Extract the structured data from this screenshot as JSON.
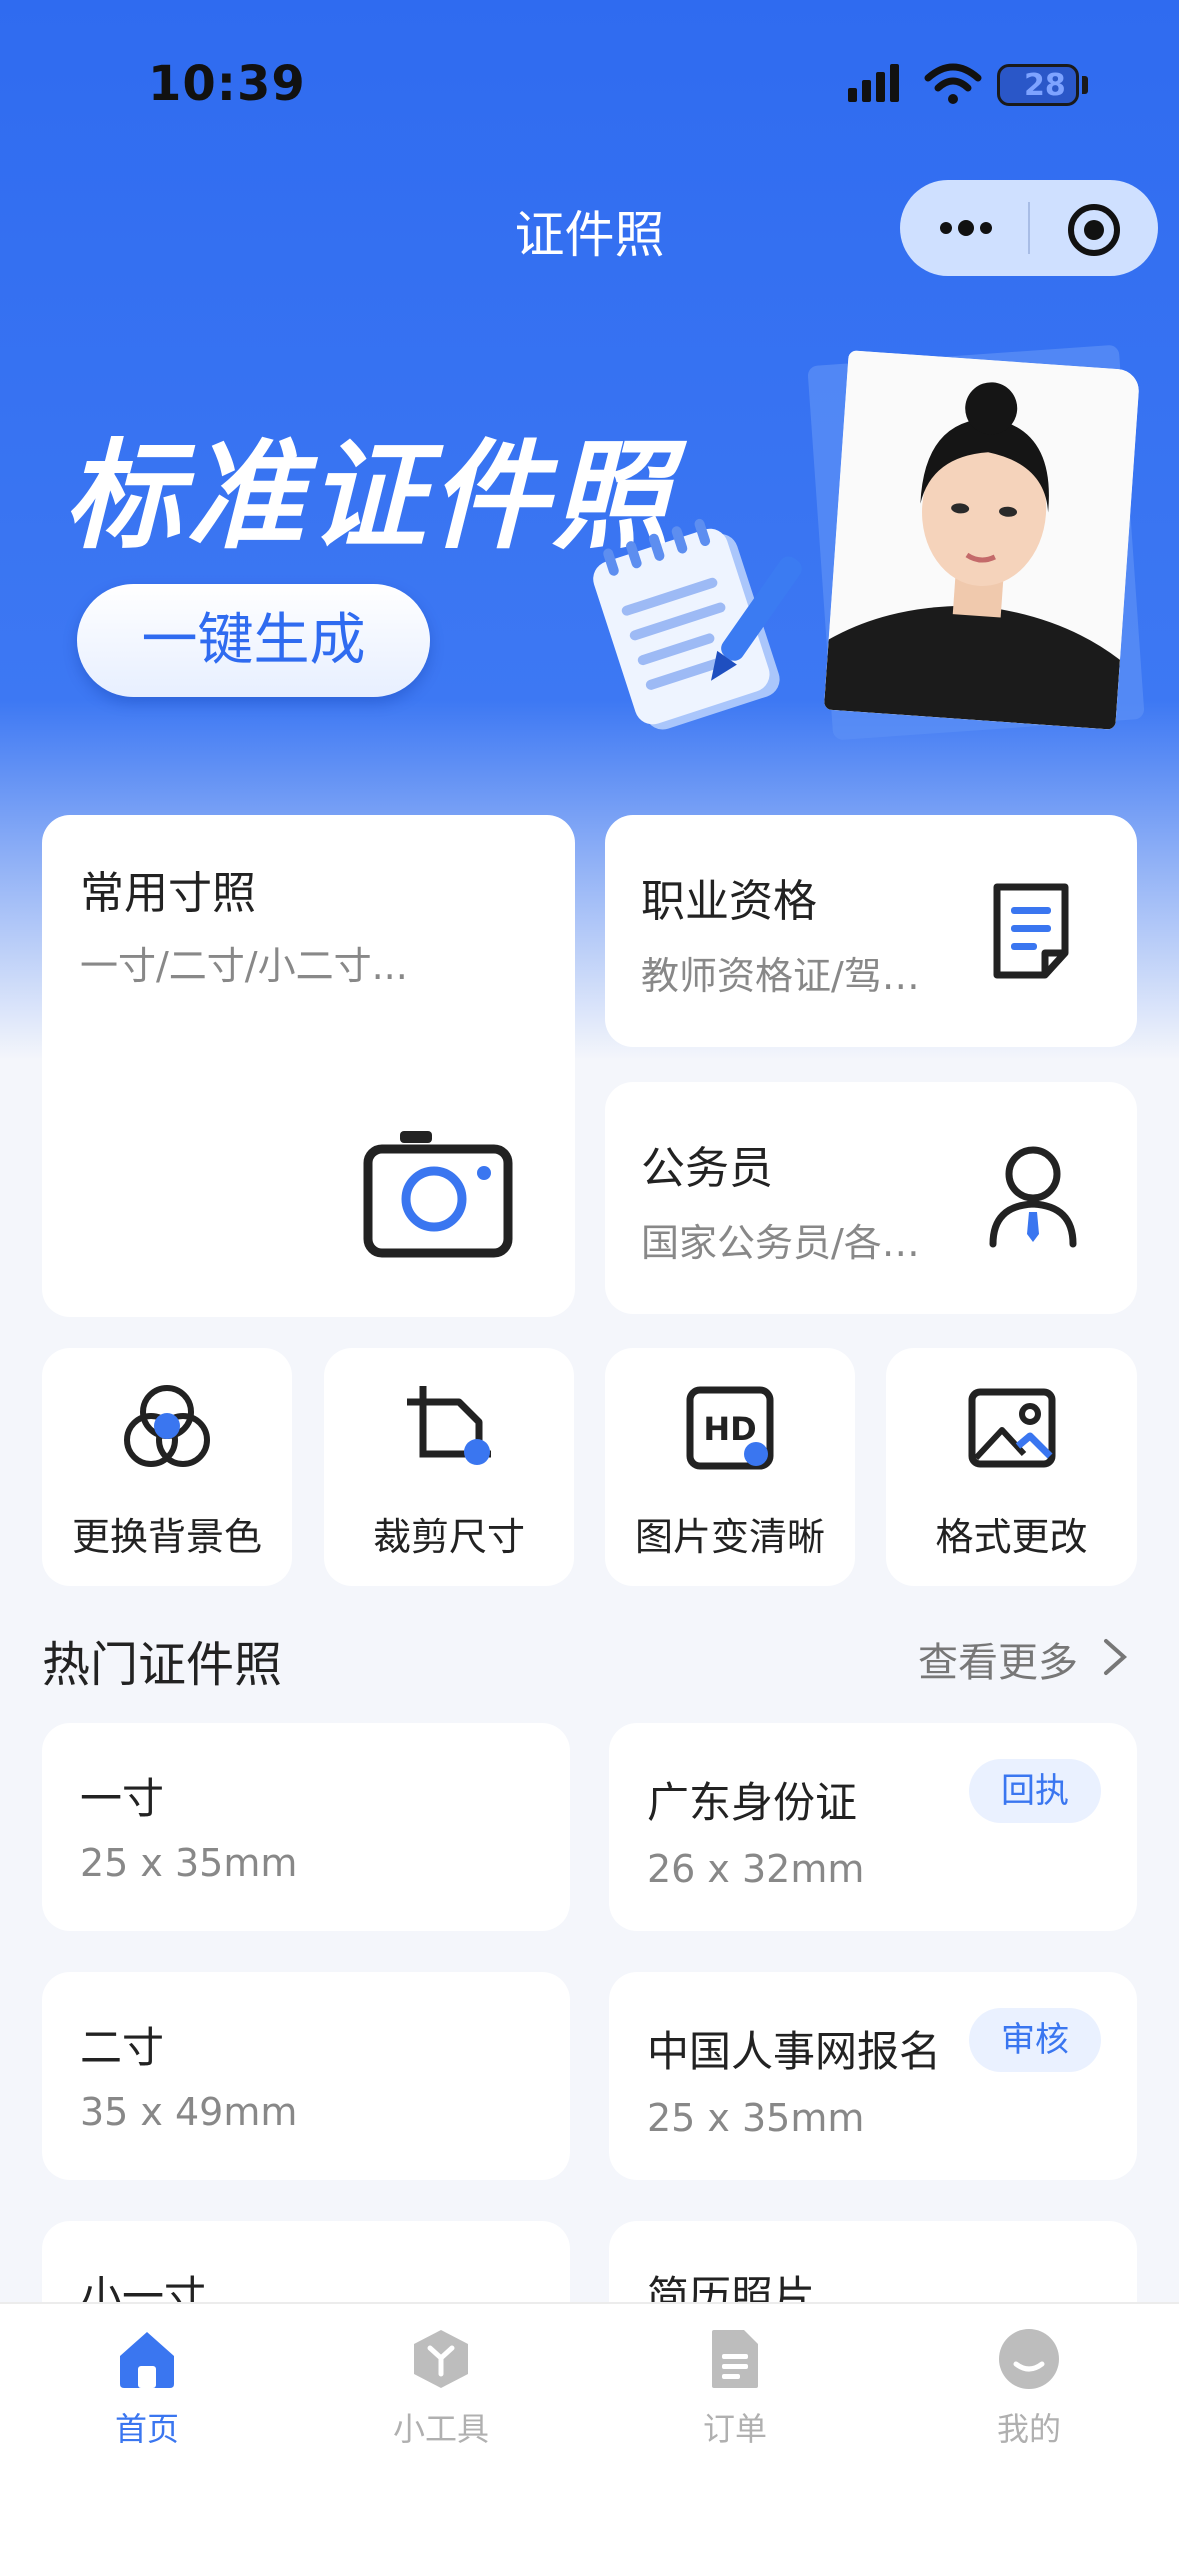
{
  "status_bar": {
    "time": "10:39",
    "battery": "28"
  },
  "nav": {
    "title": "证件照"
  },
  "hero": {
    "title": "标准证件照",
    "button": "一键生成"
  },
  "categories": {
    "common": {
      "title": "常用寸照",
      "subtitle": "一寸/二寸/小二寸..."
    },
    "professional": {
      "title": "职业资格",
      "subtitle": "教师资格证/驾…"
    },
    "civil": {
      "title": "公务员",
      "subtitle": "国家公务员/各…"
    }
  },
  "tools": [
    {
      "label": "更换背景色",
      "icon": "color-circles-icon"
    },
    {
      "label": "裁剪尺寸",
      "icon": "crop-icon"
    },
    {
      "label": "图片变清晰",
      "icon": "hd-icon"
    },
    {
      "label": "格式更改",
      "icon": "image-format-icon"
    }
  ],
  "hot": {
    "title": "热门证件照",
    "more": "查看更多",
    "items": [
      {
        "name": "一寸",
        "size": "25 x 35mm",
        "badge": ""
      },
      {
        "name": "广东身份证",
        "size": "26 x 32mm",
        "badge": "回执"
      },
      {
        "name": "二寸",
        "size": "35 x 49mm",
        "badge": ""
      },
      {
        "name": "中国人事网报名",
        "size": "25 x 35mm",
        "badge": "审核"
      },
      {
        "name": "小一寸",
        "size": "",
        "badge": ""
      },
      {
        "name": "简历照片",
        "size": "",
        "badge": ""
      }
    ]
  },
  "tabbar": [
    {
      "label": "首页",
      "icon": "home-icon",
      "active": true
    },
    {
      "label": "小工具",
      "icon": "toolbox-icon",
      "active": false
    },
    {
      "label": "订单",
      "icon": "document-icon",
      "active": false
    },
    {
      "label": "我的",
      "icon": "profile-icon",
      "active": false
    }
  ],
  "colors": {
    "primary": "#2f6bf0",
    "accent": "#3a76f0",
    "badge_bg": "#eaf1ff"
  }
}
